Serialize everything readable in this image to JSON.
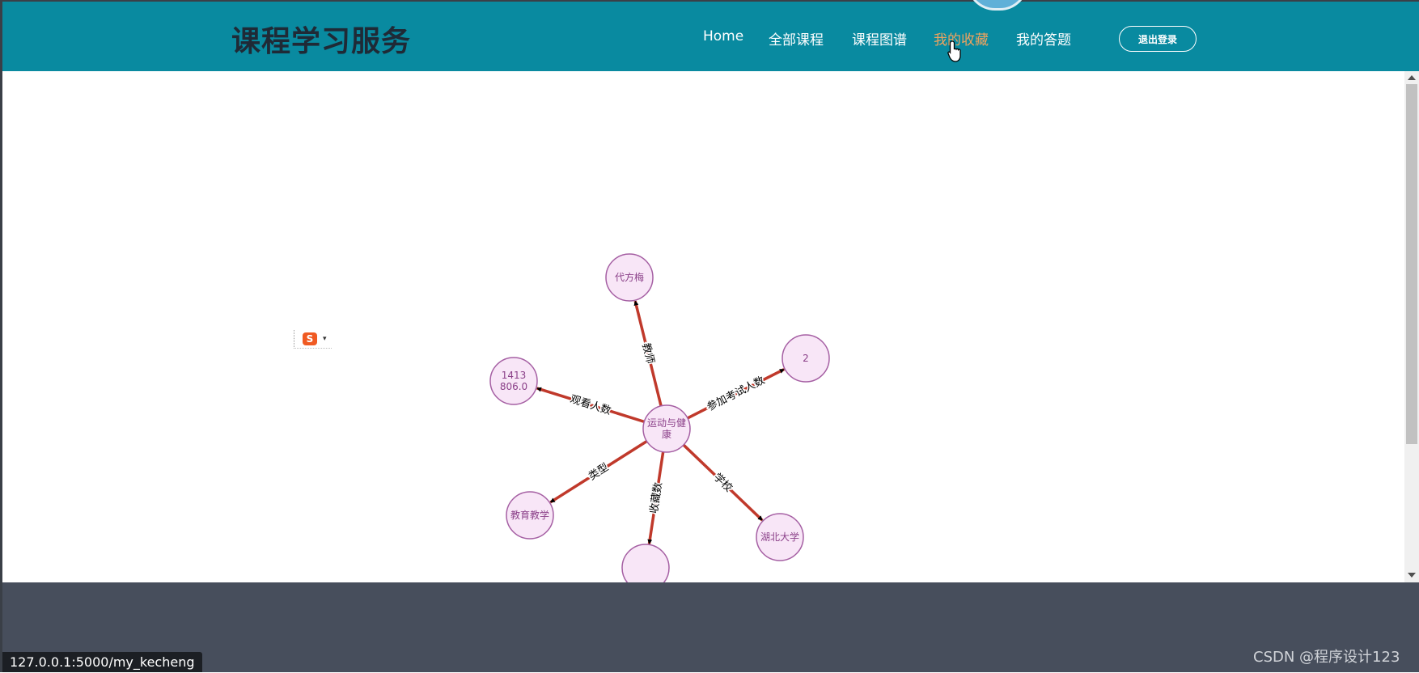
{
  "header": {
    "site_title": "课程学习服务",
    "nav": [
      {
        "label": "Home"
      },
      {
        "label": "全部课程"
      },
      {
        "label": "课程图谱"
      },
      {
        "label": "我的收藏"
      },
      {
        "label": "我的答题"
      }
    ],
    "active_nav": "我的收藏",
    "logout_label": "退出登录"
  },
  "graph": {
    "center": {
      "label_lines": [
        "运动与健",
        "康"
      ]
    },
    "nodes": [
      {
        "label_lines": [
          "代方梅"
        ],
        "edge_label": "教师"
      },
      {
        "label_lines": [
          "2"
        ],
        "edge_label": "参加考试人数"
      },
      {
        "label_lines": [
          "1413",
          "806.0"
        ],
        "edge_label": "观看人数"
      },
      {
        "label_lines": [
          "教育教学"
        ],
        "edge_label": "类型"
      },
      {
        "label_lines": [
          ""
        ],
        "edge_label": "收藏数"
      },
      {
        "label_lines": [
          "湖北大学"
        ],
        "edge_label": "学校"
      }
    ],
    "colors": {
      "edge": "#c0392b",
      "node_fill": "#f8e6f7",
      "node_stroke": "#a55fa3",
      "node_text": "#8a3f88"
    }
  },
  "ime": {
    "glyph": "S"
  },
  "status_url": "127.0.0.1:5000/my_kecheng",
  "watermark": "CSDN @程序设计123",
  "colors": {
    "header": "#098aa0",
    "footer": "#474e5c",
    "active_nav": "#f0a35e"
  }
}
